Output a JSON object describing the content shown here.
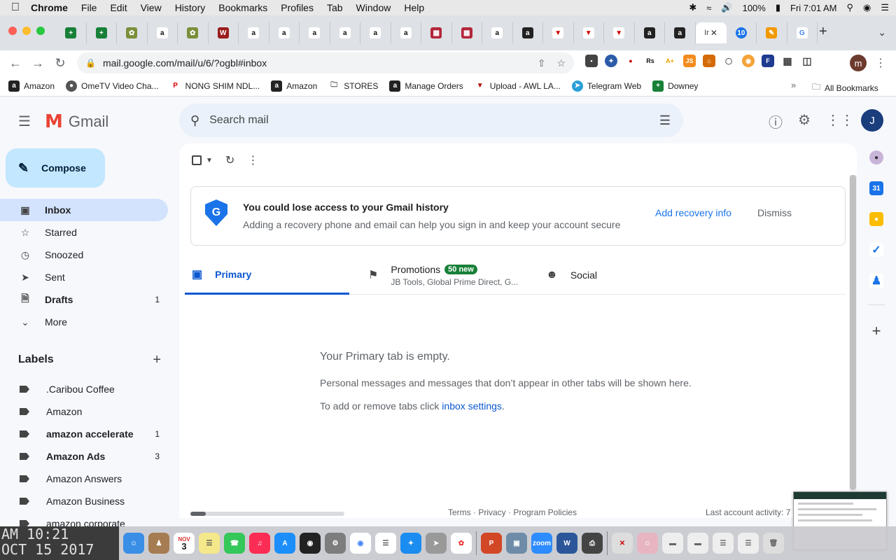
{
  "menubar": {
    "app": "Chrome",
    "items": [
      "File",
      "Edit",
      "View",
      "History",
      "Bookmarks",
      "Profiles",
      "Tab",
      "Window",
      "Help"
    ],
    "battery": "100%",
    "clock": "Fri 7:01 AM"
  },
  "tabs": {
    "active_label": "Ir",
    "count_badge": "10"
  },
  "toolbar": {
    "url": "mail.google.com/mail/u/6/?ogbl#inbox",
    "profile_initial": "m"
  },
  "bookmarks": {
    "items": [
      "Amazon",
      "OmeTV Video Cha...",
      "NONG SHIM NDL...",
      "Amazon",
      "STORES",
      "Manage Orders",
      "Upload - AWL LA...",
      "Telegram Web",
      "Downey"
    ],
    "more": "»",
    "all": "All Bookmarks"
  },
  "gmail": {
    "logo_text": "Gmail",
    "search_placeholder": "Search mail",
    "avatar_initial": "J",
    "compose": "Compose",
    "nav": [
      {
        "label": "Inbox",
        "count": ""
      },
      {
        "label": "Starred",
        "count": ""
      },
      {
        "label": "Snoozed",
        "count": ""
      },
      {
        "label": "Sent",
        "count": ""
      },
      {
        "label": "Drafts",
        "count": "1"
      },
      {
        "label": "More",
        "count": ""
      }
    ],
    "labels_heading": "Labels",
    "labels": [
      {
        "label": ".Caribou Coffee",
        "count": ""
      },
      {
        "label": "Amazon",
        "count": ""
      },
      {
        "label": "amazon accelerate",
        "count": "1"
      },
      {
        "label": "Amazon Ads",
        "count": "3"
      },
      {
        "label": "Amazon Answers",
        "count": ""
      },
      {
        "label": "Amazon Business",
        "count": ""
      },
      {
        "label": "amazon corporate",
        "count": ""
      }
    ],
    "banner": {
      "title": "You could lose access to your Gmail history",
      "subtitle": "Adding a recovery phone and email can help you sign in and keep your account secure",
      "add": "Add recovery info",
      "dismiss": "Dismiss"
    },
    "tabs": {
      "primary": "Primary",
      "promotions": "Promotions",
      "promotions_badge": "50 new",
      "promotions_sub": "JB Tools, Global Prime Direct, G...",
      "social": "Social"
    },
    "empty": {
      "title": "Your Primary tab is empty.",
      "body": "Personal messages and messages that don’t appear in other tabs will be shown here.",
      "settings_prefix": "To add or remove tabs click ",
      "settings_link": "inbox settings",
      "settings_suffix": "."
    },
    "footer": {
      "links": "Terms · Privacy · Program Policies",
      "activity": "Last account activity: 7"
    }
  },
  "desktop": {
    "line1": "AM 10:21",
    "line2": "OCT 15 2017"
  },
  "dock": {
    "calendar_month": "NOV",
    "calendar_day": "3",
    "zoom_label": "zoom"
  }
}
